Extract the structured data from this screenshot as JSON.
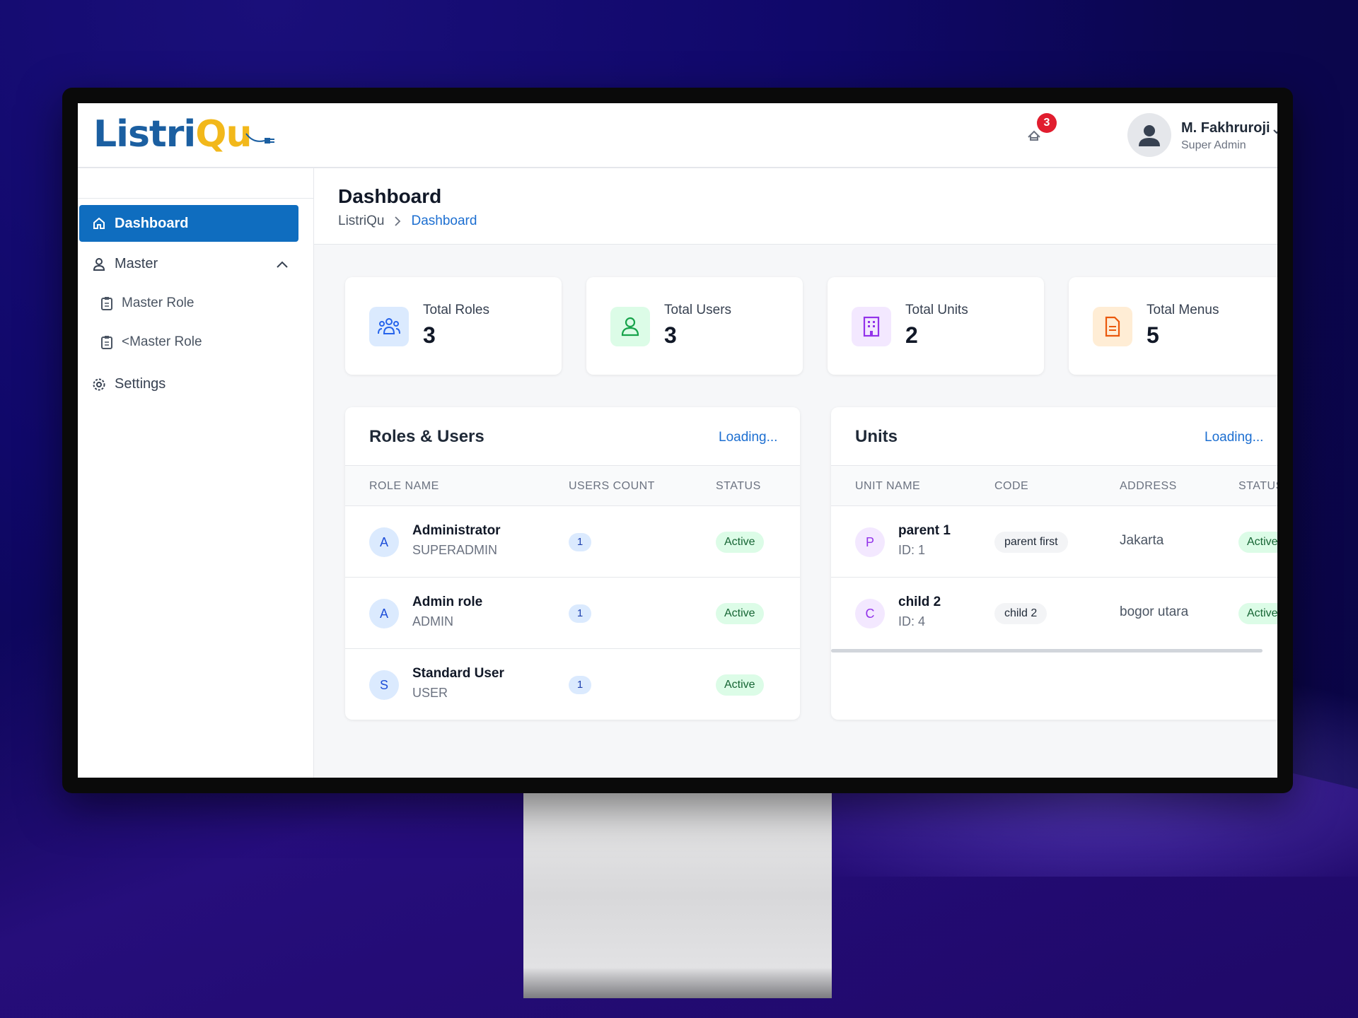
{
  "header": {
    "logo_text_1": "Listri",
    "logo_text_2": "Q",
    "logo_text_3": "u",
    "notification_count": "3",
    "user_name": "M. Fakhruroji",
    "user_role": "Super Admin"
  },
  "sidebar": {
    "items": [
      {
        "label": "Dashboard",
        "icon": "home-icon",
        "active": true
      },
      {
        "label": "Master",
        "icon": "user-icon",
        "expanded": true
      },
      {
        "label": "Master Role",
        "icon": "clipboard-icon"
      },
      {
        "label": "<Master Role",
        "icon": "clipboard-icon"
      },
      {
        "label": "Settings",
        "icon": "gear-icon"
      }
    ]
  },
  "page": {
    "title": "Dashboard",
    "breadcrumb_root": "ListriQu",
    "breadcrumb_current": "Dashboard"
  },
  "stats": [
    {
      "label": "Total Roles",
      "value": "3",
      "icon": "users-group-icon",
      "color": "#2563eb",
      "bg": "#dbeafe"
    },
    {
      "label": "Total Users",
      "value": "3",
      "icon": "user-icon",
      "color": "#16a34a",
      "bg": "#dcfce7"
    },
    {
      "label": "Total Units",
      "value": "2",
      "icon": "building-icon",
      "color": "#9333ea",
      "bg": "#f3e8ff"
    },
    {
      "label": "Total Menus",
      "value": "5",
      "icon": "document-icon",
      "color": "#ea580c",
      "bg": "#ffedd5"
    }
  ],
  "roles_panel": {
    "title": "Roles & Users",
    "link": "Loading...",
    "columns": [
      "ROLE NAME",
      "USERS COUNT",
      "STATUS"
    ],
    "rows": [
      {
        "initial": "A",
        "name": "Administrator",
        "code": "SUPERADMIN",
        "count": "1",
        "status": "Active"
      },
      {
        "initial": "A",
        "name": "Admin role",
        "code": "ADMIN",
        "count": "1",
        "status": "Active"
      },
      {
        "initial": "S",
        "name": "Standard User",
        "code": "USER",
        "count": "1",
        "status": "Active"
      }
    ]
  },
  "units_panel": {
    "title": "Units",
    "link": "Loading...",
    "columns": [
      "UNIT NAME",
      "CODE",
      "ADDRESS",
      "STATUS"
    ],
    "rows": [
      {
        "initial": "P",
        "name": "parent 1",
        "id": "ID: 1",
        "code": "parent first",
        "address": "Jakarta",
        "status": "Active"
      },
      {
        "initial": "C",
        "name": "child 2",
        "id": "ID: 4",
        "code": "child 2",
        "address": "bogor utara",
        "status": "Active"
      }
    ]
  },
  "colors": {
    "primary": "#0f6dbf",
    "link": "#1d6fd1",
    "badge": "#e11d2e"
  }
}
